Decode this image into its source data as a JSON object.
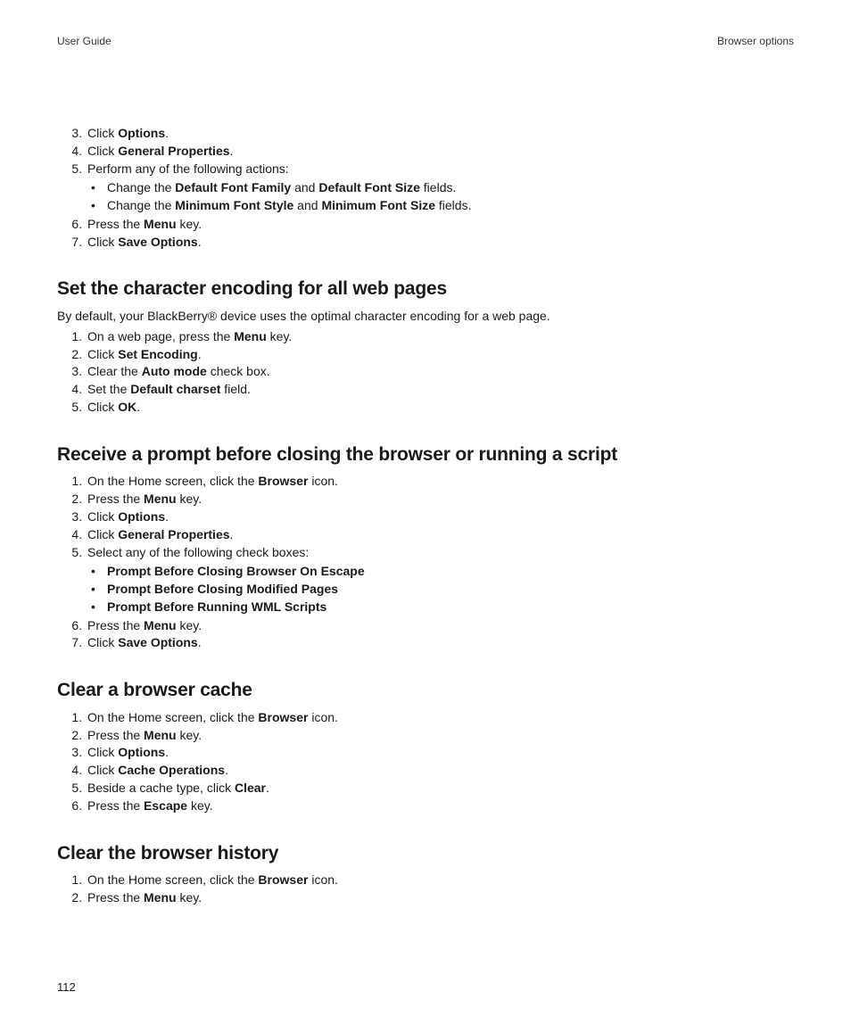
{
  "header": {
    "left": "User Guide",
    "right": "Browser options"
  },
  "section0": {
    "ol_start": 3,
    "li3_a": "Click ",
    "li3_b": "Options",
    "li3_c": ".",
    "li4_a": "Click ",
    "li4_b": "General Properties",
    "li4_c": ".",
    "li5": "Perform any of the following actions:",
    "li5_sub1_a": "Change the ",
    "li5_sub1_b": "Default Font Family",
    "li5_sub1_c": " and ",
    "li5_sub1_d": "Default Font Size",
    "li5_sub1_e": " fields.",
    "li5_sub2_a": "Change the ",
    "li5_sub2_b": "Minimum Font Style",
    "li5_sub2_c": " and ",
    "li5_sub2_d": "Minimum Font Size",
    "li5_sub2_e": " fields.",
    "li6_a": "Press the ",
    "li6_b": "Menu",
    "li6_c": " key.",
    "li7_a": "Click ",
    "li7_b": "Save Options",
    "li7_c": "."
  },
  "section1": {
    "heading": "Set the character encoding for all web pages",
    "intro": "By default, your BlackBerry® device uses the optimal character encoding for a web page.",
    "li1_a": "On a web page, press the ",
    "li1_b": "Menu",
    "li1_c": " key.",
    "li2_a": "Click ",
    "li2_b": "Set Encoding",
    "li2_c": ".",
    "li3_a": "Clear the ",
    "li3_b": "Auto mode",
    "li3_c": " check box.",
    "li4_a": "Set the ",
    "li4_b": "Default charset",
    "li4_c": " field.",
    "li5_a": "Click ",
    "li5_b": "OK",
    "li5_c": "."
  },
  "section2": {
    "heading": "Receive a prompt before closing the browser or running a script",
    "li1_a": "On the Home screen, click the ",
    "li1_b": "Browser",
    "li1_c": " icon.",
    "li2_a": "Press the ",
    "li2_b": "Menu",
    "li2_c": " key.",
    "li3_a": "Click ",
    "li3_b": "Options",
    "li3_c": ".",
    "li4_a": "Click ",
    "li4_b": "General Properties",
    "li4_c": ".",
    "li5": "Select any of the following check boxes:",
    "li5_sub1": "Prompt Before Closing Browser On Escape",
    "li5_sub2": "Prompt Before Closing Modified Pages",
    "li5_sub3": "Prompt Before Running WML Scripts",
    "li6_a": "Press the ",
    "li6_b": "Menu",
    "li6_c": " key.",
    "li7_a": "Click ",
    "li7_b": "Save Options",
    "li7_c": "."
  },
  "section3": {
    "heading": "Clear a browser cache",
    "li1_a": "On the Home screen, click the ",
    "li1_b": "Browser",
    "li1_c": " icon.",
    "li2_a": "Press the ",
    "li2_b": "Menu",
    "li2_c": " key.",
    "li3_a": "Click ",
    "li3_b": "Options",
    "li3_c": ".",
    "li4_a": "Click ",
    "li4_b": "Cache Operations",
    "li4_c": ".",
    "li5_a": "Beside a cache type, click ",
    "li5_b": "Clear",
    "li5_c": ".",
    "li6_a": "Press the ",
    "li6_b": "Escape",
    "li6_c": " key."
  },
  "section4": {
    "heading": "Clear the browser history",
    "li1_a": "On the Home screen, click the ",
    "li1_b": "Browser",
    "li1_c": " icon.",
    "li2_a": "Press the ",
    "li2_b": "Menu",
    "li2_c": " key."
  },
  "footer": {
    "page": "112"
  }
}
